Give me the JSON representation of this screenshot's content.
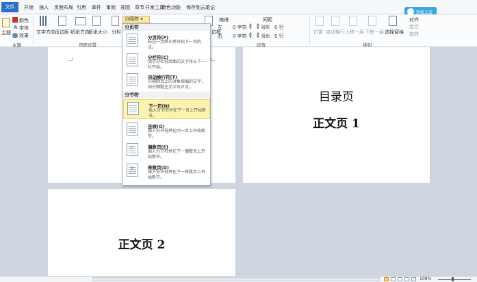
{
  "menu": {
    "file": "文件",
    "tabs": [
      "开始",
      "插入",
      "页面布局",
      "引用",
      "邮件",
      "审阅",
      "视图",
      "章节",
      "开发工具",
      "特色功能",
      "保存到云笔记"
    ],
    "cloud_button": "轻松上云"
  },
  "ribbon": {
    "theme_btn": "主题",
    "colors": "颜色",
    "fonts": "字体",
    "effects": "效果",
    "text_direction": "文字方向",
    "margins": "页边距",
    "orientation": "纸张方向",
    "size": "纸张大小",
    "columns": "分栏",
    "breaks_button": "分隔符",
    "borders": "边框",
    "indent_label": "缩进",
    "indent_left_prefix": "左",
    "indent_right_prefix": "右",
    "indent_left": "0 字符",
    "indent_right": "0 字符",
    "spacing_label": "间距",
    "spacing_before_prefix": "段前",
    "spacing_after_prefix": "段后",
    "spacing_before": "0 行",
    "spacing_after": "0 行",
    "position": "位置",
    "wrap": "自动换行",
    "bring_forward": "上移一层",
    "send_backward": "下移一层",
    "selection_pane": "选择窗格",
    "align": "对齐",
    "group_obj": "组合",
    "rotate": "旋转",
    "groups": {
      "theme": "主题",
      "page_setup": "页面设置",
      "paragraph": "段落",
      "arrange": "排列"
    }
  },
  "dropdown": {
    "section_page": "分页符",
    "section_section": "分节符",
    "items": [
      {
        "title": "分页符(P)",
        "desc": "标记一页终止并开始下一页的点。"
      },
      {
        "title": "分栏符(C)",
        "desc": "指示分栏符后面的文字将从下一栏开始。"
      },
      {
        "title": "自动换行符(T)",
        "desc": "分隔网页上的对象周围的文字，如分隔题注文字与正文。"
      },
      {
        "title": "下一页(N)",
        "desc": "插入分节符并在下一页上开始新节。"
      },
      {
        "title": "连续(O)",
        "desc": "插入分节符并在同一页上开始新节。"
      },
      {
        "title": "偶数页(E)",
        "desc": "插入分节符并在下一偶数页上开始新节。"
      },
      {
        "title": "奇数页(D)",
        "desc": "插入分节符并在下一奇数页上开始新节。"
      }
    ],
    "even_num": "2",
    "odd_num": "3"
  },
  "pages": {
    "toc": "目录页",
    "body1": "正文页 1",
    "body2": "正文页 2"
  },
  "status": {
    "zoom": "109%"
  },
  "colors": {
    "file_tab": "#2a6fc9",
    "highlight": "#fdf3b0",
    "workspace": "#ced5de",
    "cloud": "#39a8e0"
  }
}
